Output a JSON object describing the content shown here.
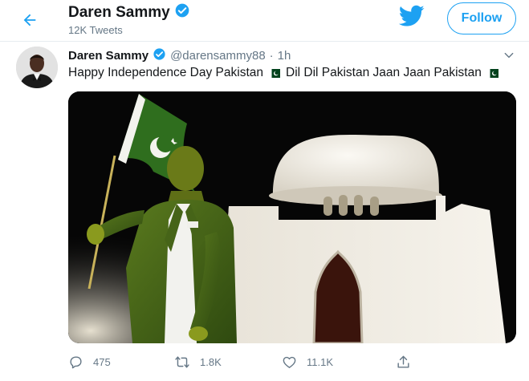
{
  "header": {
    "name": "Daren Sammy",
    "tweet_count": "12K Tweets",
    "follow_label": "Follow"
  },
  "tweet": {
    "author_name": "Daren Sammy",
    "handle": "@darensammy88",
    "separator": "·",
    "time": "1h",
    "text_part1": "Happy Independence Day Pakistan",
    "text_part2": "Dil Dil Pakistan Jaan Jaan Pakistan"
  },
  "actions": {
    "reply_count": "475",
    "retweet_count": "1.8K",
    "like_count": "11.1K"
  },
  "icons": {
    "back": "arrow-left-icon",
    "verified": "verified-badge-icon",
    "brand": "twitter-bird-icon",
    "more": "chevron-down-icon",
    "reply": "reply-icon",
    "retweet": "retweet-icon",
    "like": "heart-icon",
    "share": "share-icon",
    "flag": "pakistan-flag-emoji"
  },
  "colors": {
    "accent": "#1da1f2",
    "secondary_text": "#657786",
    "primary_text": "#14171a",
    "flag_green": "#01411c"
  }
}
